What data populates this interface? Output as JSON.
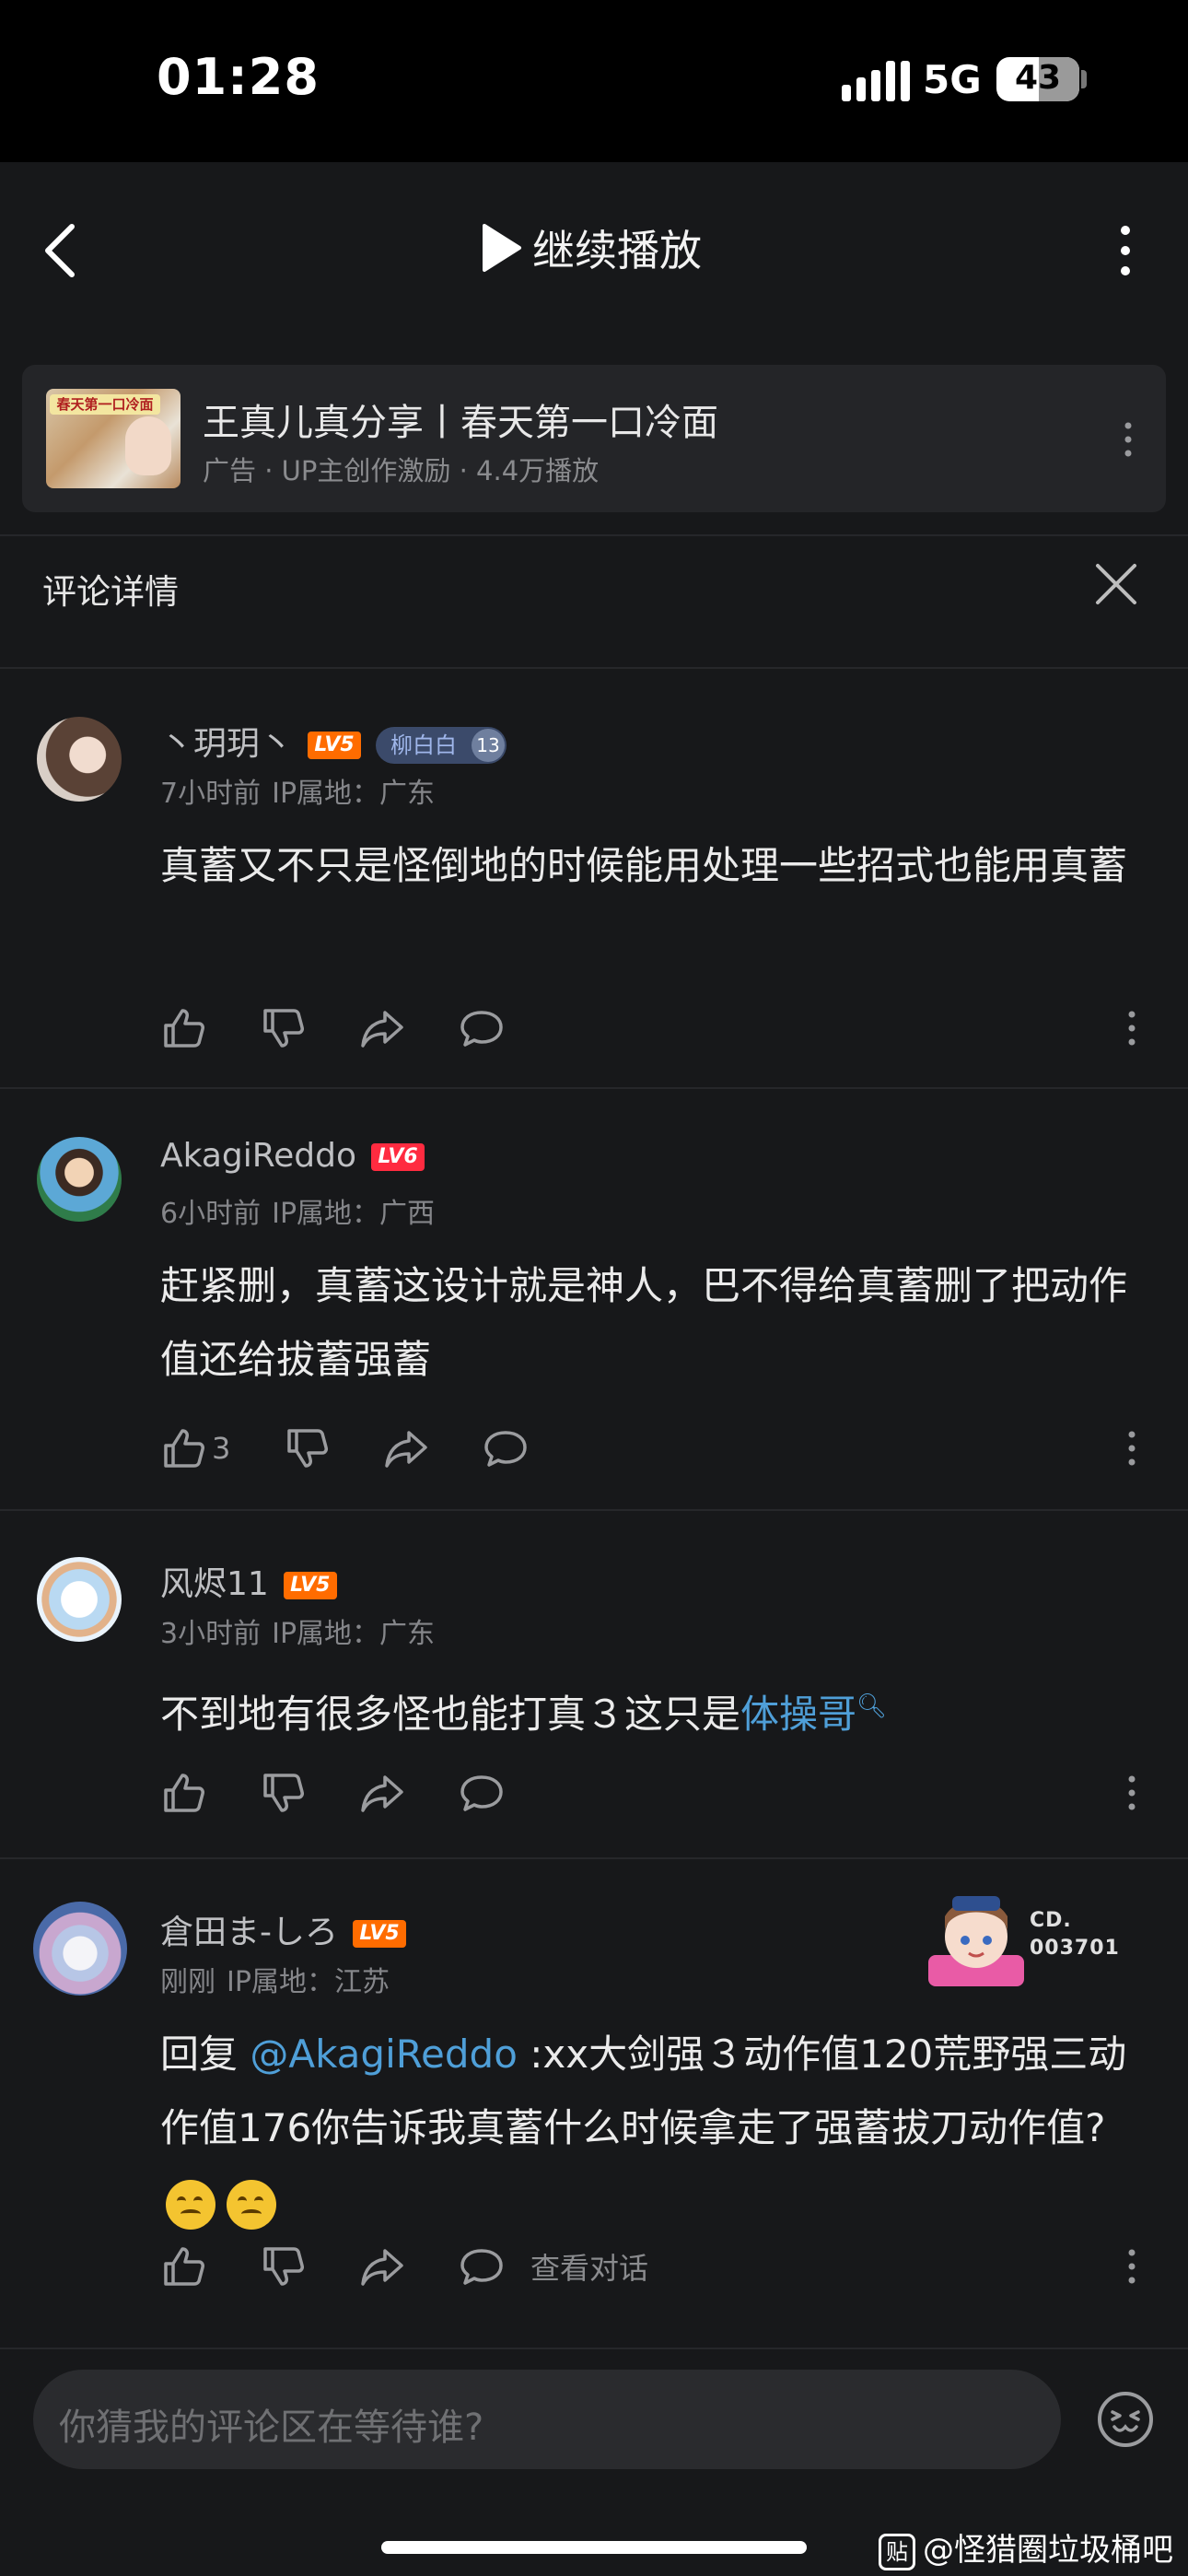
{
  "status_bar": {
    "time": "01:28",
    "network": "5G",
    "battery": "43"
  },
  "nav": {
    "continue_label": "继续播放"
  },
  "video": {
    "thumb_banner": "春天第一口冷面",
    "title": "王真儿真分享丨春天第一口冷面",
    "meta": "广告 · UP主创作激励 · 4.4万播放"
  },
  "detail_title": "评论详情",
  "comments": [
    {
      "user": "丶玥玥丶",
      "level": "LV5",
      "fan_badge": {
        "name": "柳白白",
        "level": "13"
      },
      "time": "7小时前",
      "ip": "IP属地：广东",
      "text": "真蓄又不只是怪倒地的时候能用处理一些招式也能用真蓄"
    },
    {
      "user": "AkagiReddo",
      "level": "LV6",
      "time": "6小时前",
      "ip": "IP属地：广西",
      "text": "赶紧删，真蓄这设计就是神人，巴不得给真蓄删了把动作值还给拔蓄强蓄",
      "likes": "3"
    },
    {
      "user": "风烬11",
      "level": "LV5",
      "time": "3小时前",
      "ip": "IP属地：广东",
      "text_prefix": "不到地有很多怪也能打真３这只是",
      "text_link": "体操哥"
    },
    {
      "user": "倉田ま-しろ",
      "level": "LV5",
      "time": "刚刚",
      "ip": "IP属地：江苏",
      "reply_prefix": "回复 ",
      "reply_to": "@AkagiReddo",
      "text": " :xx大剑强３动作值120荒野强三动作值176你告诉我真蓄什么时候拿走了强蓄拔刀动作值?",
      "decor_id_1": "CD.",
      "decor_id_2": "003701",
      "view_conversation": "查看对话"
    }
  ],
  "input": {
    "placeholder": "你猜我的评论区在等待谁?"
  },
  "watermark": {
    "badge": "贴",
    "text": "@怪猎圈垃圾桶吧"
  },
  "colors": {
    "background": "#17181a",
    "link": "#4f9fd8",
    "lv5": "#ff6c00",
    "lv6": "#ff2b40"
  }
}
